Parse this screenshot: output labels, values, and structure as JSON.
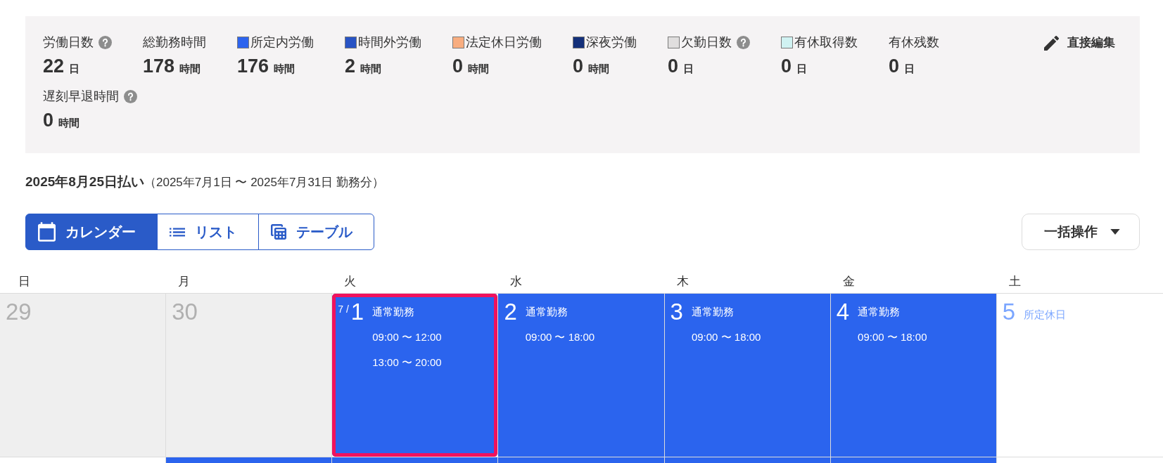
{
  "summary": {
    "stats": [
      {
        "label": "労働日数",
        "help": true,
        "value": "22",
        "unit": "日"
      },
      {
        "label": "総勤務時間",
        "help": false,
        "value": "178",
        "unit": "時間"
      },
      {
        "label": "所定内労働",
        "color": "#2d64ee",
        "help": false,
        "value": "176",
        "unit": "時間"
      },
      {
        "label": "時間外労働",
        "color": "#2853c4",
        "help": false,
        "value": "2",
        "unit": "時間"
      },
      {
        "label": "法定休日労働",
        "color": "#f8ad80",
        "help": false,
        "value": "0",
        "unit": "時間"
      },
      {
        "label": "深夜労働",
        "color": "#14307a",
        "help": false,
        "value": "0",
        "unit": "時間"
      },
      {
        "label": "欠勤日数",
        "color": "#e0dede",
        "help": true,
        "value": "0",
        "unit": "日"
      },
      {
        "label": "有休取得数",
        "color": "#d0f2f2",
        "help": false,
        "value": "0",
        "unit": "日"
      },
      {
        "label": "有休残数",
        "help": false,
        "value": "0",
        "unit": "日"
      },
      {
        "label": "遅刻早退時間",
        "help": true,
        "value": "0",
        "unit": "時間"
      }
    ],
    "edit_button": {
      "label": "直接編集"
    }
  },
  "pay_period": {
    "title": "2025年8月25日払い",
    "range": "（2025年7月1日 〜 2025年7月31日 勤務分）"
  },
  "view_tabs": [
    {
      "label": "カレンダー",
      "selected": true
    },
    {
      "label": "リスト",
      "selected": false
    },
    {
      "label": "テーブル",
      "selected": false
    }
  ],
  "bulk_action": {
    "label": "一括操作"
  },
  "calendar": {
    "weekdays": [
      "日",
      "月",
      "火",
      "水",
      "木",
      "金",
      "土"
    ],
    "weeks": [
      {
        "days": [
          {
            "kind": "outside",
            "number": "29",
            "selected": false
          },
          {
            "kind": "outside",
            "number": "30",
            "selected": false
          },
          {
            "kind": "work",
            "month": "7 /",
            "number": "1",
            "label": "通常勤務",
            "times": [
              "09:00 〜 12:00",
              "13:00 〜 20:00"
            ],
            "selected": true
          },
          {
            "kind": "work",
            "number": "2",
            "label": "通常勤務",
            "times": [
              "09:00 〜 18:00"
            ],
            "selected": false
          },
          {
            "kind": "work",
            "number": "3",
            "label": "通常勤務",
            "times": [
              "09:00 〜 18:00"
            ],
            "selected": false
          },
          {
            "kind": "work",
            "number": "4",
            "label": "通常勤務",
            "times": [
              "09:00 〜 18:00"
            ],
            "selected": false
          },
          {
            "kind": "holiday",
            "number": "5",
            "label": "所定休日",
            "selected": false
          }
        ]
      },
      {
        "days": [
          {
            "kind": "holiday"
          },
          {
            "kind": "work"
          },
          {
            "kind": "work"
          },
          {
            "kind": "work"
          },
          {
            "kind": "work"
          },
          {
            "kind": "work"
          },
          {
            "kind": "holiday"
          }
        ]
      }
    ]
  }
}
